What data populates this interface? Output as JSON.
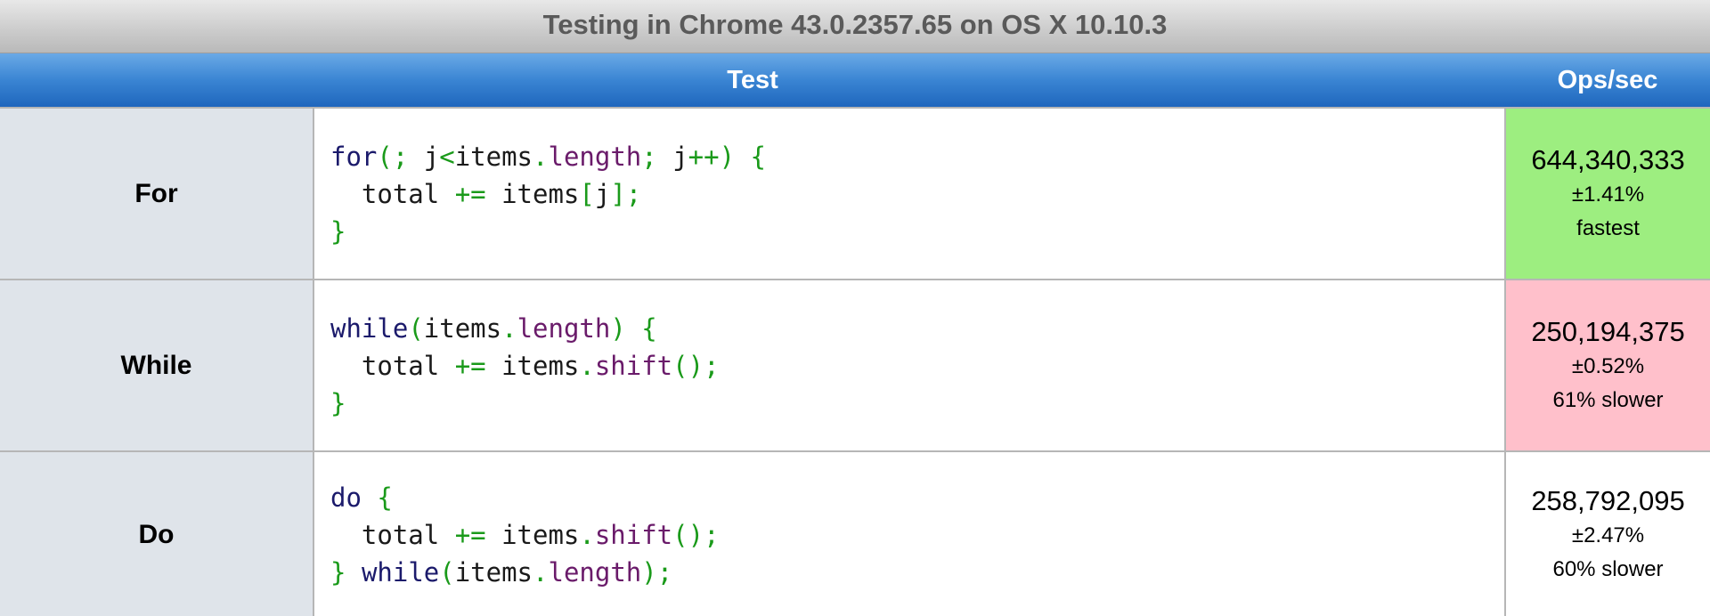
{
  "caption": "Testing in Chrome 43.0.2357.65 on OS X 10.10.3",
  "headers": {
    "test": "Test",
    "ops": "Ops/sec"
  },
  "colors": {
    "fastest": "#9dee80",
    "slow": "#ffc0cb",
    "neutral": "#ffffff"
  },
  "rows": [
    {
      "name": "For",
      "code": [
        [
          [
            "kw",
            "for"
          ],
          [
            "pun",
            "("
          ],
          [
            "pun",
            ";"
          ],
          [
            "id",
            " j"
          ],
          [
            "pun",
            "<"
          ],
          [
            "id",
            "items"
          ],
          [
            "pun",
            "."
          ],
          [
            "prop",
            "length"
          ],
          [
            "pun",
            ";"
          ],
          [
            "id",
            " j"
          ],
          [
            "pun",
            "++"
          ],
          [
            "pun",
            ")"
          ],
          [
            "id",
            " "
          ],
          [
            "pun",
            "{"
          ]
        ],
        [
          [
            "id",
            "  total "
          ],
          [
            "pun",
            "+="
          ],
          [
            "id",
            " items"
          ],
          [
            "pun",
            "["
          ],
          [
            "id",
            "j"
          ],
          [
            "pun",
            "]"
          ],
          [
            "pun",
            ";"
          ]
        ],
        [
          [
            "pun",
            "}"
          ]
        ]
      ],
      "ops": "644,340,333",
      "margin": "±1.41%",
      "note": "fastest",
      "status": "fastest"
    },
    {
      "name": "While",
      "code": [
        [
          [
            "kw",
            "while"
          ],
          [
            "pun",
            "("
          ],
          [
            "id",
            "items"
          ],
          [
            "pun",
            "."
          ],
          [
            "prop",
            "length"
          ],
          [
            "pun",
            ")"
          ],
          [
            "id",
            " "
          ],
          [
            "pun",
            "{"
          ]
        ],
        [
          [
            "id",
            "  total "
          ],
          [
            "pun",
            "+="
          ],
          [
            "id",
            " items"
          ],
          [
            "pun",
            "."
          ],
          [
            "prop",
            "shift"
          ],
          [
            "pun",
            "()"
          ],
          [
            "pun",
            ";"
          ]
        ],
        [
          [
            "pun",
            "}"
          ]
        ]
      ],
      "ops": "250,194,375",
      "margin": "±0.52%",
      "note": "61% slower",
      "status": "slow"
    },
    {
      "name": "Do",
      "code": [
        [
          [
            "kw",
            "do"
          ],
          [
            "id",
            " "
          ],
          [
            "pun",
            "{"
          ]
        ],
        [
          [
            "id",
            "  total "
          ],
          [
            "pun",
            "+="
          ],
          [
            "id",
            " items"
          ],
          [
            "pun",
            "."
          ],
          [
            "prop",
            "shift"
          ],
          [
            "pun",
            "()"
          ],
          [
            "pun",
            ";"
          ]
        ],
        [
          [
            "pun",
            "}"
          ],
          [
            "id",
            " "
          ],
          [
            "kw",
            "while"
          ],
          [
            "pun",
            "("
          ],
          [
            "id",
            "items"
          ],
          [
            "pun",
            "."
          ],
          [
            "prop",
            "length"
          ],
          [
            "pun",
            ")"
          ],
          [
            "pun",
            ";"
          ]
        ]
      ],
      "ops": "258,792,095",
      "margin": "±2.47%",
      "note": "60% slower",
      "status": "neutral"
    }
  ]
}
